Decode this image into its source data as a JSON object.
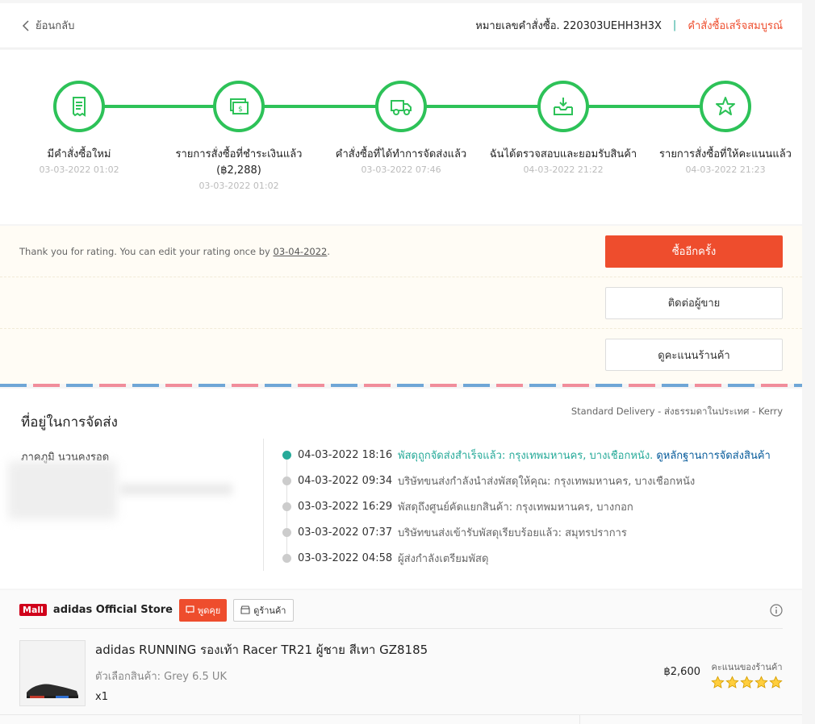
{
  "header": {
    "back_label": "ย้อนกลับ",
    "order_number": "หมายเลขคำสั่งซื้อ. 220303UEHH3H3X",
    "separator": "|",
    "order_status": "คำสั่งซื้อเสร็จสมบูรณ์"
  },
  "steps": [
    {
      "label": "มีคำสั่งซื้อใหม่",
      "time": "03-03-2022 01:02",
      "icon": "receipt-icon"
    },
    {
      "label": "รายการสั่งซื้อที่ชำระเงินแล้ว (฿2,288)",
      "time": "03-03-2022 01:02",
      "icon": "money-icon"
    },
    {
      "label": "คำสั่งซื้อที่ได้ทำการจัดส่งแล้ว",
      "time": "03-03-2022 07:46",
      "icon": "truck-icon"
    },
    {
      "label": "ฉันได้ตรวจสอบและยอมรับสินค้า",
      "time": "04-03-2022 21:22",
      "icon": "inbox-download-icon"
    },
    {
      "label": "รายการสั่งซื้อที่ให้คะแนนแล้ว",
      "time": "04-03-2022 21:23",
      "icon": "star-icon"
    }
  ],
  "actions": {
    "thanks_text": "Thank you for rating. You can edit your rating once by ",
    "thanks_date": "03-04-2022",
    "thanks_end": ".",
    "buy_again": "ซื้ออีกครั้ง",
    "contact_seller": "ติดต่อผู้ขาย",
    "view_shop_rating": "ดูคะแนนร้านค้า"
  },
  "address": {
    "title": "ที่อยู่ในการจัดส่ง",
    "delivery_method": "Standard Delivery - ส่งธรรมดาในประเทศ - Kerry",
    "name": "ภาคภูมิ นวนคงรอด",
    "events": [
      {
        "time": "04-03-2022 18:16",
        "desc": "พัสดุถูกจัดส่งสำเร็จแล้ว: กรุงเทพมหานคร, บางเชือกหนัง.",
        "link": "ดูหลักฐานการจัดส่งสินค้า",
        "active": true
      },
      {
        "time": "04-03-2022 09:34",
        "desc": "บริษัทขนส่งกำลังนำส่งพัสดุให้คุณ: กรุงเทพมหานคร, บางเชือกหนัง",
        "link": "",
        "active": false
      },
      {
        "time": "03-03-2022 16:29",
        "desc": "พัสดุถึงศูนย์คัดแยกสินค้า: กรุงเทพมหานคร, บางกอก",
        "link": "",
        "active": false
      },
      {
        "time": "03-03-2022 07:37",
        "desc": "บริษัทขนส่งเข้ารับพัสดุเรียบร้อยแล้ว: สมุทรปราการ",
        "link": "",
        "active": false
      },
      {
        "time": "03-03-2022 04:58",
        "desc": "ผู้ส่งกำลังเตรียมพัสดุ",
        "link": "",
        "active": false
      }
    ]
  },
  "store": {
    "mall_badge": "Mall",
    "name": "adidas Official Store",
    "chat_label": "พูดคุย",
    "shop_label": "ดูร้านค้า"
  },
  "product": {
    "title": "adidas RUNNING รองเท้า Racer TR21 ผู้ชาย สีเทา GZ8185",
    "variation": "ตัวเลือกสินค้า: Grey 6.5 UK",
    "quantity": "x1",
    "price": "฿2,600",
    "rating_label": "คะแนนของร้านค้า",
    "stars": 5
  },
  "colors": {
    "accent": "#ee4d2d",
    "green": "#2dc258",
    "teal": "#26aa99"
  }
}
